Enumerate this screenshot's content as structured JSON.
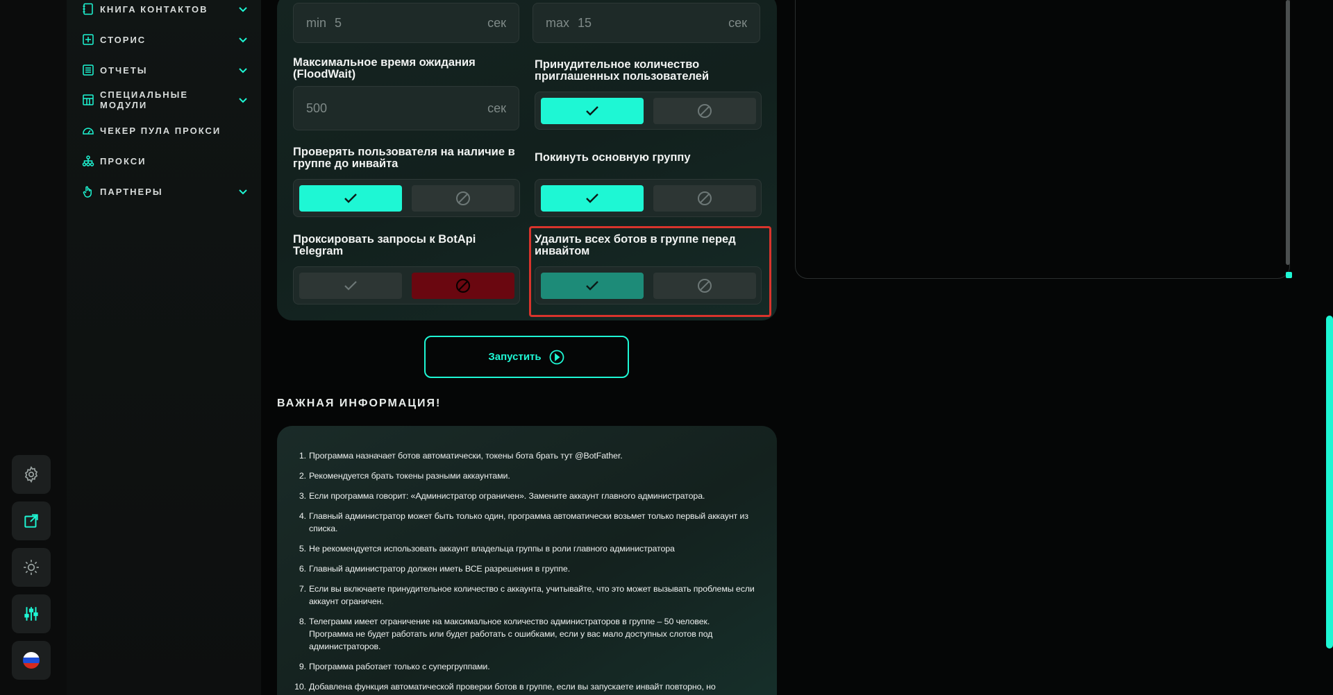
{
  "sidebar": {
    "items": [
      {
        "label": "Книга контактов",
        "icon": "contacts-book-icon",
        "expandable": true
      },
      {
        "label": "Сторис",
        "icon": "plus-square-icon",
        "expandable": true
      },
      {
        "label": "Отчеты",
        "icon": "report-icon",
        "expandable": true
      },
      {
        "label": "Специальные модули",
        "icon": "modules-icon",
        "expandable": true
      },
      {
        "label": "Чекер пула прокси",
        "icon": "speedometer-icon",
        "expandable": false
      },
      {
        "label": "Прокси",
        "icon": "network-icon",
        "expandable": false
      },
      {
        "label": "Партнеры",
        "icon": "hand-icon",
        "expandable": true
      }
    ]
  },
  "rail": {
    "buttons": [
      "settings-gear-icon",
      "external-link-icon",
      "theme-sun-icon",
      "sliders-icon",
      "language-flag-ru-icon"
    ]
  },
  "form": {
    "delay_min": {
      "prefix": "min",
      "value": "5",
      "unit": "сек"
    },
    "delay_max": {
      "prefix": "max",
      "value": "15",
      "unit": "сек"
    },
    "floodwait": {
      "label": "Максимальное время ожидания (FloodWait)",
      "value": "500",
      "unit": "сек"
    },
    "forced_count": {
      "label": "Принудительное количество приглашенных пользователей",
      "state": "yes"
    },
    "check_user": {
      "label": "Проверять пользователя на наличие в группе до инвайта",
      "state": "yes"
    },
    "leave_group": {
      "label": "Покинуть основную группу",
      "state": "yes"
    },
    "proxy_botapi": {
      "label": "Проксировать запросы к BotApi Telegram",
      "state": "no"
    },
    "delete_bots": {
      "label": "Удалить всех ботов в группе перед инвайтом",
      "state": "yes"
    }
  },
  "start_button": {
    "label": "Запустить"
  },
  "info": {
    "title": "ВАЖНАЯ ИНФОРМАЦИЯ!",
    "items": [
      "Программа назначает ботов автоматически, токены бота брать тут @BotFather.",
      "Рекомендуется брать токены разными аккаунтами.",
      "Если программа говорит: «Администратор огpаничен». Замените аккаунт главного администратора.",
      "Главный администратор может быть только один, программа автоматически возьмет только первый аккаунт из списка.",
      "Не рекомендуется использовать аккаунт владельца группы в роли главного администратора",
      "Главный администратор должен иметь ВСЕ разрешения в группе.",
      "Если вы включаете принудительное количество с аккаунта, учитывайте, что это может вызывать проблемы если аккаунт ограничен.",
      "Телеграмм имеет ограничение на максимальное количество администраторов в группе – 50 человек. Программа не будет работать или будет работать с ошибками, если у вас мало доступных слотов под администраторов.",
      "Программа работает только с супергруппами.",
      "Добавлена функция автоматической проверки ботов в группе, если вы запускаете инвайт повторно, но"
    ]
  },
  "colors": {
    "accent": "#1ef7d4",
    "accent_dim": "#1d8b78",
    "danger": "#6a0710",
    "highlight": "#d8342c"
  }
}
